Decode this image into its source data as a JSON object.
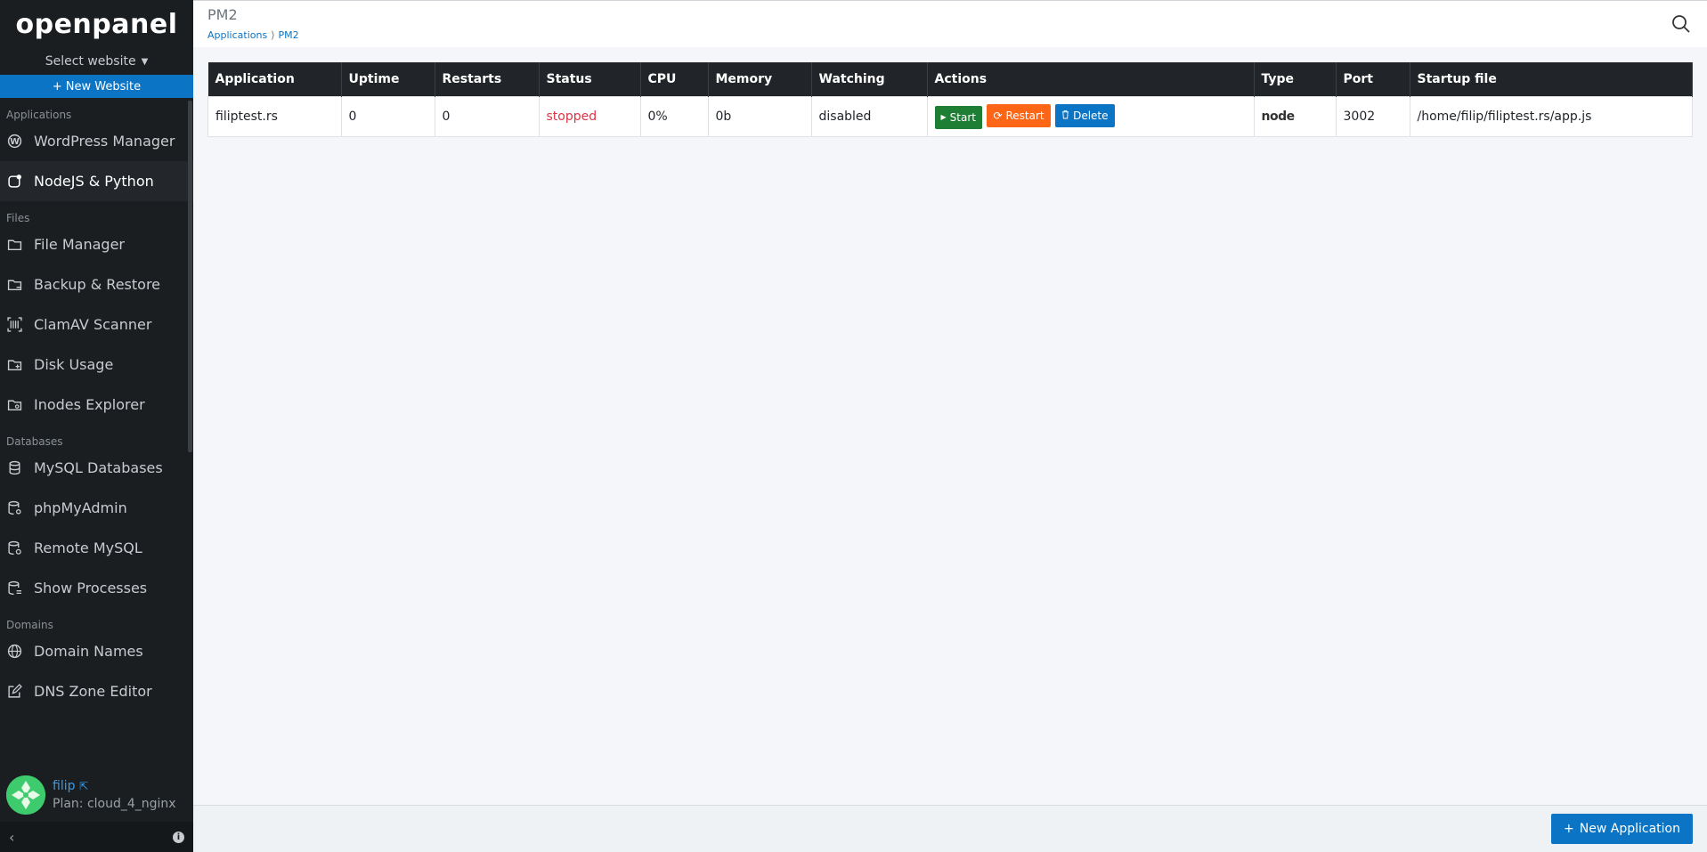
{
  "sidebar": {
    "logo": "openpanel",
    "select_website": "Select website",
    "new_website": "New Website",
    "sections": [
      {
        "label": "Applications",
        "items": [
          {
            "label": "WordPress Manager",
            "icon": "wordpress-icon"
          },
          {
            "label": "NodeJS & Python",
            "icon": "app-indicator-icon",
            "active": true
          }
        ]
      },
      {
        "label": "Files",
        "items": [
          {
            "label": "File Manager",
            "icon": "folder-icon"
          },
          {
            "label": "Backup & Restore",
            "icon": "folder-backup-icon"
          },
          {
            "label": "ClamAV Scanner",
            "icon": "barcode-scan-icon"
          },
          {
            "label": "Disk Usage",
            "icon": "folder-plus-icon"
          },
          {
            "label": "Inodes Explorer",
            "icon": "folder-search-icon"
          }
        ]
      },
      {
        "label": "Databases",
        "items": [
          {
            "label": "MySQL Databases",
            "icon": "database-icon"
          },
          {
            "label": "phpMyAdmin",
            "icon": "database-gear-icon"
          },
          {
            "label": "Remote MySQL",
            "icon": "database-remote-icon"
          },
          {
            "label": "Show Processes",
            "icon": "database-list-icon"
          }
        ]
      },
      {
        "label": "Domains",
        "items": [
          {
            "label": "Domain Names",
            "icon": "globe-icon"
          },
          {
            "label": "DNS Zone Editor",
            "icon": "edit-square-icon"
          }
        ]
      }
    ],
    "user": {
      "name": "filip",
      "plan": "Plan: cloud_4_nginx"
    }
  },
  "header": {
    "title": "PM2",
    "breadcrumb": [
      "Applications",
      "PM2"
    ]
  },
  "table": {
    "columns": [
      "Application",
      "Uptime",
      "Restarts",
      "Status",
      "CPU",
      "Memory",
      "Watching",
      "Actions",
      "Type",
      "Port",
      "Startup file"
    ],
    "rows": [
      {
        "application": "filiptest.rs",
        "uptime": "0",
        "restarts": "0",
        "status": "stopped",
        "cpu": "0%",
        "memory": "0b",
        "watching": "disabled",
        "actions": {
          "start": "Start",
          "restart": "Restart",
          "delete": "Delete"
        },
        "type": "node",
        "port": "3002",
        "startup_file": "/home/filip/filiptest.rs/app.js"
      }
    ]
  },
  "footer": {
    "new_application": "New Application"
  },
  "colors": {
    "sidebar_bg": "#1b1e21",
    "accent": "#0b74c4",
    "start": "#1e7e34",
    "restart": "#fd6517",
    "stopped": "#dc3545"
  }
}
